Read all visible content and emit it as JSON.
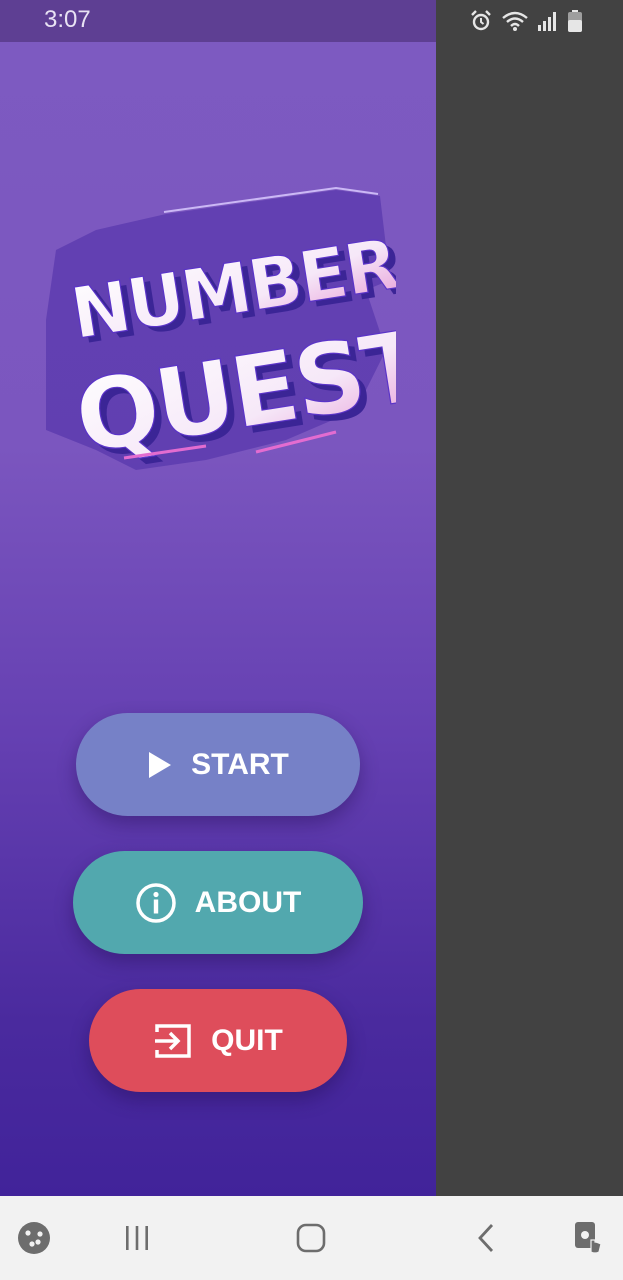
{
  "status_bar": {
    "time": "3:07",
    "icons": [
      "alarm-icon",
      "wifi-icon",
      "signal-icon",
      "battery-icon"
    ]
  },
  "app": {
    "logo": {
      "line1": "NUMBER",
      "line2": "QUEST"
    },
    "buttons": {
      "start": {
        "label": "START",
        "icon": "play-icon",
        "color": "#7681c7"
      },
      "about": {
        "label": "ABOUT",
        "icon": "info-icon",
        "color": "#52a8ae"
      },
      "quit": {
        "label": "QUIT",
        "icon": "exit-icon",
        "color": "#de4d5b"
      }
    }
  },
  "nav_bar": {
    "items": [
      "game-launcher-icon",
      "recent-apps-icon",
      "home-icon",
      "back-icon",
      "assistant-touch-icon"
    ]
  },
  "colors": {
    "panel_top": "#7d5ac1",
    "panel_bottom": "#41239a",
    "side_panel": "#424242"
  }
}
